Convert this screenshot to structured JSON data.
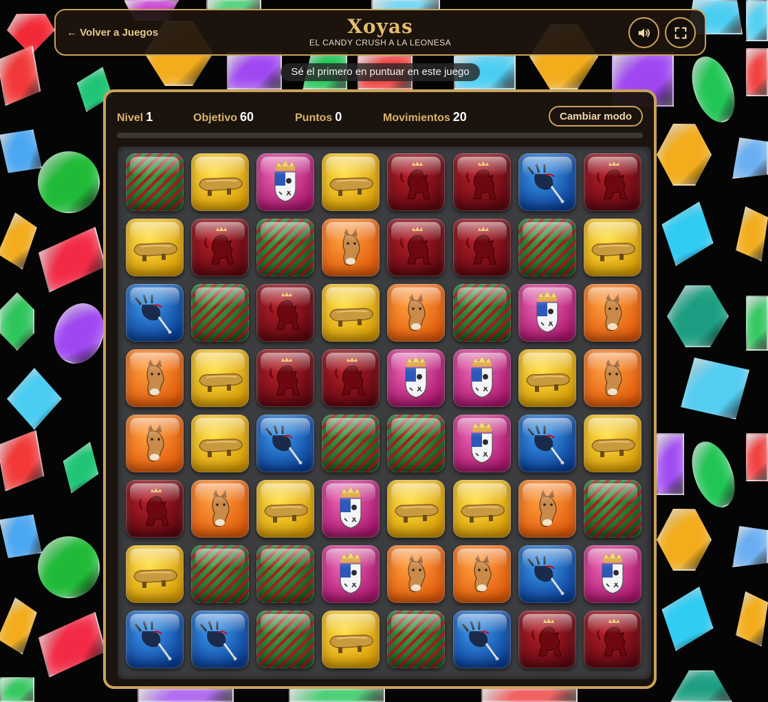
{
  "header": {
    "back_label": "← Volver a Juegos",
    "title": "Xoyas",
    "subtitle": "EL CANDY CRUSH A LA LEONESA",
    "sound_icon": "speaker-icon",
    "fullscreen_icon": "fullscreen-icon"
  },
  "notice": "Sé el primero en puntuar en este juego",
  "stats": {
    "level_label": "Nivel",
    "level_value": "1",
    "goal_label": "Objetivo",
    "goal_value": "60",
    "points_label": "Puntos",
    "points_value": "0",
    "moves_label": "Movimientos",
    "moves_value": "20",
    "mode_button": "Cambiar modo"
  },
  "progress": 0,
  "colors": {
    "accent": "#c9a35a",
    "panel": "#1c140f",
    "board": "#3c3d3f"
  },
  "tile_types": {
    "G": {
      "name": "green-striped-tile",
      "icon": "stripes-icon",
      "color": "#2a8a35"
    },
    "Y": {
      "name": "yellow-clog-tile",
      "icon": "madrena-clog-icon",
      "color": "#f2c20f"
    },
    "P": {
      "name": "pink-coat-of-arms-tile",
      "icon": "coat-of-arms-icon",
      "color": "#d23b93"
    },
    "R": {
      "name": "red-lion-tile",
      "icon": "lion-icon",
      "color": "#8a0f18"
    },
    "B": {
      "name": "blue-bagpipe-tile",
      "icon": "bagpipe-icon",
      "color": "#1c6fd0"
    },
    "O": {
      "name": "orange-donkey-tile",
      "icon": "donkey-icon",
      "color": "#f57a1a"
    }
  },
  "board": [
    [
      "G",
      "Y",
      "P",
      "Y",
      "R",
      "R",
      "B",
      "R"
    ],
    [
      "Y",
      "R",
      "G",
      "O",
      "R",
      "R",
      "G",
      "Y"
    ],
    [
      "B",
      "G",
      "R",
      "Y",
      "O",
      "G",
      "P",
      "O"
    ],
    [
      "O",
      "Y",
      "R",
      "R",
      "P",
      "P",
      "Y",
      "O"
    ],
    [
      "O",
      "Y",
      "B",
      "G",
      "G",
      "P",
      "B",
      "Y"
    ],
    [
      "R",
      "O",
      "Y",
      "P",
      "Y",
      "Y",
      "O",
      "G"
    ],
    [
      "Y",
      "G",
      "G",
      "P",
      "O",
      "O",
      "B",
      "P"
    ],
    [
      "B",
      "B",
      "G",
      "Y",
      "G",
      "B",
      "R",
      "R"
    ]
  ]
}
